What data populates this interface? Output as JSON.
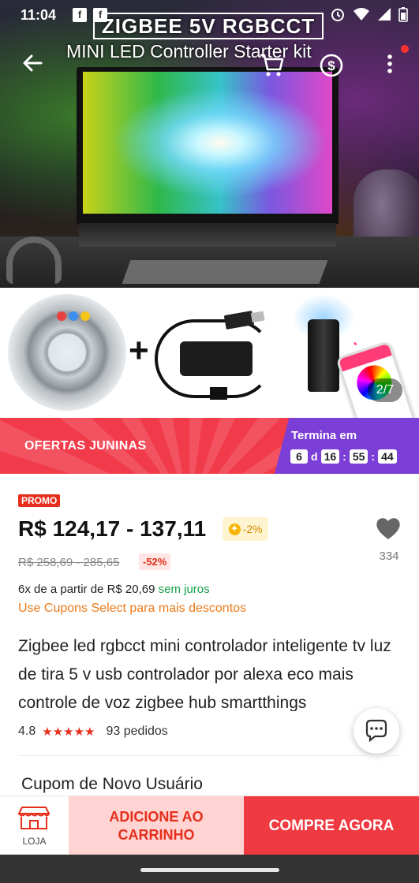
{
  "status_bar": {
    "time": "11:04"
  },
  "hero": {
    "title_line1": "ZIGBEE 5V RGBCCT",
    "title_line2": "MINI LED Controller Starter kit"
  },
  "kit": {
    "image_counter": "2/7"
  },
  "promo_banner": {
    "label": "OFERTAS JUNINAS",
    "ends_label": "Termina em",
    "days": "6",
    "days_unit": "d",
    "hours": "16",
    "minutes": "55",
    "seconds": "44"
  },
  "product": {
    "promo_tag": "PROMO",
    "price": "R$ 124,17 - 137,11",
    "coin_discount": "-2%",
    "old_price": "R$ 258,69 - 285,65",
    "discount": "-52%",
    "likes": "334",
    "installments": "6x de a partir de R$ 20,69",
    "installments_free": "sem juros",
    "coupon_link": "Use Cupons Select para mais descontos",
    "title": "Zigbee led rgbcct mini controlador inteligente tv luz de tira 5 v usb controlador por alexa eco mais controle de voz zigbee hub smartthings",
    "rating": "4.8",
    "orders": "93 pedidos"
  },
  "coupon_section": {
    "title": "Cupom de Novo Usuário"
  },
  "bottom_bar": {
    "store_label": "LOJA",
    "add_to_cart": "ADICIONE AO CARRINHO",
    "buy_now": "COMPRE AGORA"
  },
  "colors": {
    "accent_red": "#f03a42",
    "discount_red": "#e62e1c",
    "banner_purple": "#7b3ed6",
    "link_orange": "#ee7a1a",
    "green": "#12a04a"
  }
}
